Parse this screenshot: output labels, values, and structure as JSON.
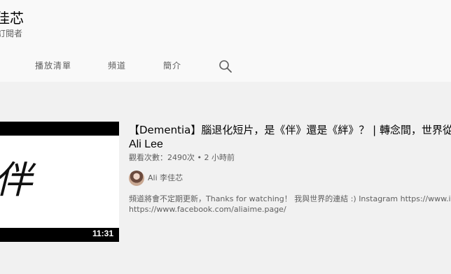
{
  "channel": {
    "name": "佳芯",
    "subscribers": "訂閱者"
  },
  "tabs": [
    {
      "label": "播放清單"
    },
    {
      "label": "頻道"
    },
    {
      "label": "簡介"
    }
  ],
  "video": {
    "title": "【Dementia】腦退化短片，是《伴》還是《絆》？ | 轉念間，世界從",
    "title_line2": "Ali Lee",
    "meta": "觀看次數：2490次 • 2 小時前",
    "author": "Ali 李佳芯",
    "duration": "11:31",
    "thumbnail_text": "伴",
    "description_line1": "頻道將會不定期更新，Thanks for watching！ 我與世界的連結 :) Instagram https://www.instagram.com",
    "description_line2": "https://www.facebook.com/aliaime.page/"
  },
  "icons": {
    "search": "search-icon"
  }
}
